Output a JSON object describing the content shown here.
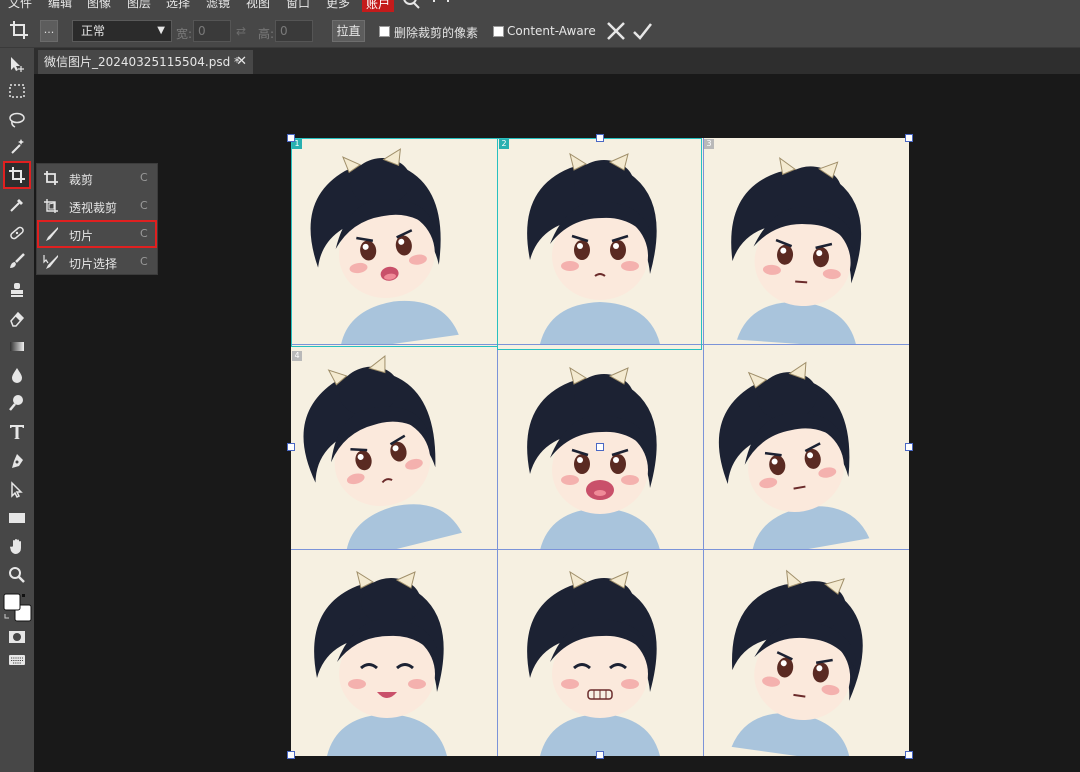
{
  "menubar": {
    "items": [
      "文件",
      "编辑",
      "图像",
      "图层",
      "选择",
      "滤镜",
      "视图",
      "窗口",
      "更多"
    ],
    "account": "账户",
    "icons": [
      "search-icon",
      "fullscreen-icon"
    ]
  },
  "options_bar": {
    "more_button": "...",
    "mode_select": "正常",
    "width_label": "宽:",
    "width_value": "0",
    "height_label": "高:",
    "height_value": "0",
    "straighten_button": "拉直",
    "delete_cropped_label": "删除裁剪的像素",
    "content_aware_label": "Content-Aware",
    "cancel_icon": "x-icon",
    "commit_icon": "check-icon"
  },
  "tab": {
    "title": "微信图片_20240325115504.psd *",
    "close": "✕"
  },
  "flyout": {
    "items": [
      {
        "label": "裁剪",
        "shortcut": "C",
        "icon": "crop-icon"
      },
      {
        "label": "透视裁剪",
        "shortcut": "C",
        "icon": "perspective-crop-icon"
      },
      {
        "label": "切片",
        "shortcut": "C",
        "icon": "slice-icon"
      },
      {
        "label": "切片选择",
        "shortcut": "C",
        "icon": "slice-select-icon"
      }
    ]
  },
  "slices": {
    "numbers": [
      "1",
      "2",
      "3",
      "4"
    ]
  },
  "colors": {
    "accent_red": "#e02020",
    "panel": "#474747",
    "canvas_bg": "#191919",
    "slice_line": "#28c0c0",
    "grid_line": "#7b93d8",
    "image_bg": "#f6f0e1"
  }
}
